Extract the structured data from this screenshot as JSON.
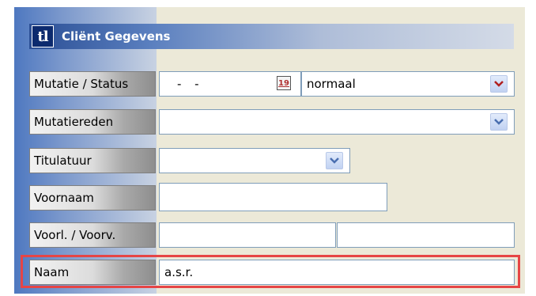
{
  "header": {
    "logo_text": "tl",
    "title": "Cliënt Gegevens"
  },
  "fields": {
    "mutatie_status": {
      "label": "Mutatie / Status",
      "date_value": "- -",
      "calendar_day": "19",
      "status_value": "normaal"
    },
    "mutatiereden": {
      "label": "Mutatiereden",
      "value": ""
    },
    "titulatuur": {
      "label": "Titulatuur",
      "value": ""
    },
    "voornaam": {
      "label": "Voornaam",
      "value": ""
    },
    "voorl_voorv": {
      "label": "Voorl. / Voorv.",
      "voorl_value": "",
      "voorv_value": ""
    },
    "naam": {
      "label": "Naam",
      "value": "a.s.r."
    }
  },
  "colors": {
    "highlight": "#e64545",
    "dropdown_arrow_active": "#b02020",
    "dropdown_arrow": "#4a6fb0"
  }
}
